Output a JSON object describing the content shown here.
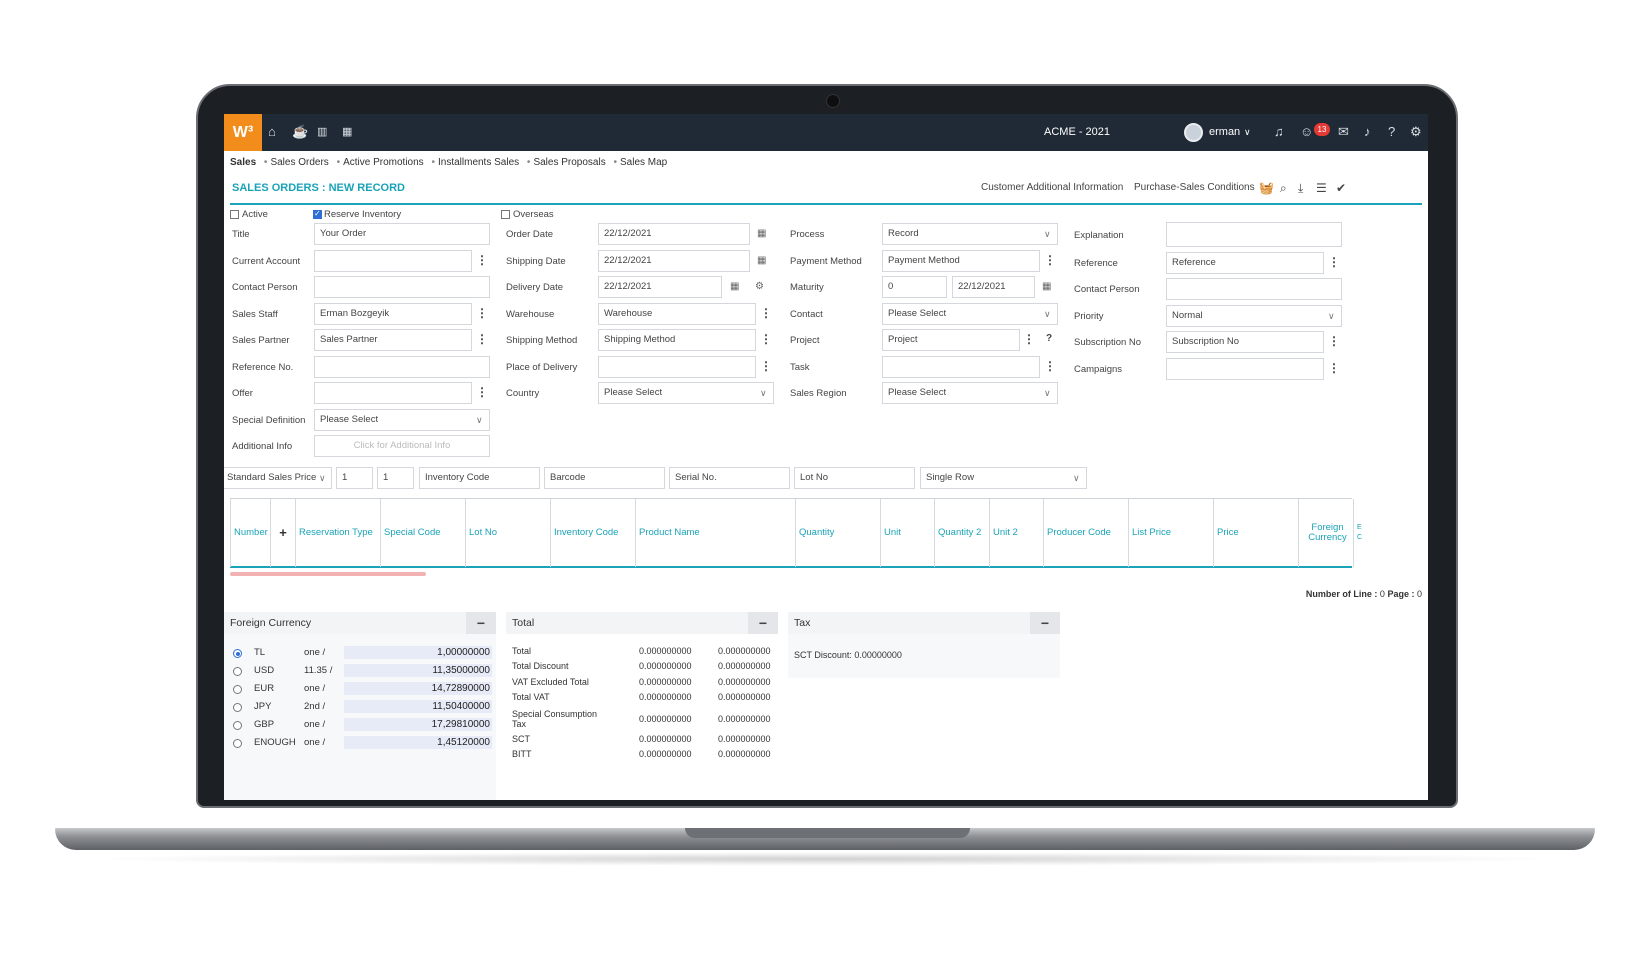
{
  "topbar": {
    "logo": "W³",
    "company": "ACME - 2021",
    "user": "erman",
    "user_chevron": "∨",
    "notif_count": "13",
    "nav_icons": [
      "home-icon",
      "coffee-icon",
      "chart-icon",
      "calendar-icon"
    ],
    "right_icons": [
      "headset-icon",
      "emoji-icon",
      "chat-icon",
      "bell-icon",
      "help-icon",
      "gear-icon"
    ]
  },
  "breadcrumbs": [
    "Sales",
    "Sales Orders",
    "Active Promotions",
    "Installments Sales",
    "Sales Proposals",
    "Sales Map"
  ],
  "page": {
    "title": "SALES ORDERS : NEW RECORD",
    "link_customer": "Customer Additional Information",
    "link_conditions": "Purchase-Sales Conditions"
  },
  "checkboxes": {
    "active": "Active",
    "reserve": "Reserve Inventory",
    "overseas": "Overseas"
  },
  "col1": {
    "title_lbl": "Title",
    "title_val": "Your Order",
    "account_lbl": "Current Account",
    "account_val": "",
    "contact_lbl": "Contact Person",
    "contact_val": "",
    "staff_lbl": "Sales Staff",
    "staff_val": "Erman Bozgeyik",
    "partner_lbl": "Sales Partner",
    "partner_val": "Sales Partner",
    "ref_lbl": "Reference No.",
    "ref_val": "",
    "offer_lbl": "Offer",
    "offer_val": "",
    "special_lbl": "Special Definition",
    "special_val": "Please Select",
    "addl_lbl": "Additional Info",
    "addl_val": "Click for Additional Info"
  },
  "col2": {
    "order_date_lbl": "Order Date",
    "order_date_val": "22/12/2021",
    "ship_date_lbl": "Shipping Date",
    "ship_date_val": "22/12/2021",
    "deliv_date_lbl": "Delivery Date",
    "deliv_date_val": "22/12/2021",
    "warehouse_lbl": "Warehouse",
    "warehouse_val": "Warehouse",
    "ship_method_lbl": "Shipping Method",
    "ship_method_val": "Shipping Method",
    "place_lbl": "Place of Delivery",
    "place_val": "",
    "country_lbl": "Country",
    "country_val": "Please Select"
  },
  "col3": {
    "process_lbl": "Process",
    "process_val": "Record",
    "payment_lbl": "Payment Method",
    "payment_val": "Payment Method",
    "maturity_lbl": "Maturity",
    "maturity_val": "0",
    "maturity_date": "22/12/2021",
    "contact_lbl": "Contact",
    "contact_val": "Please Select",
    "project_lbl": "Project",
    "project_val": "Project",
    "task_lbl": "Task",
    "task_val": "",
    "region_lbl": "Sales Region",
    "region_val": "Please Select"
  },
  "col4": {
    "expl_lbl": "Explanation",
    "expl_val": "",
    "ref_lbl": "Reference",
    "ref_val": "Reference",
    "contact_lbl": "Contact Person",
    "contact_val": "",
    "priority_lbl": "Priority",
    "priority_val": "Normal",
    "sub_lbl": "Subscription No",
    "sub_val": "Subscription No",
    "camp_lbl": "Campaigns",
    "camp_val": ""
  },
  "toolbar": {
    "price": "Standard Sales Price",
    "qty1": "1",
    "qty2": "1",
    "inv_code": "Inventory Code",
    "barcode": "Barcode",
    "serial": "Serial No.",
    "lot": "Lot No",
    "row_mode": "Single Row"
  },
  "grid": {
    "columns": [
      "Number",
      "+",
      "Reservation Type",
      "Special Code",
      "Lot No",
      "Inventory Code",
      "Product Name",
      "Quantity",
      "Unit",
      "Quantity 2",
      "Unit 2",
      "Producer Code",
      "List Price",
      "Price",
      "Foreign Currency",
      "E C"
    ],
    "line_label": "Number of Line :",
    "line_value": "0",
    "page_label": "Page :",
    "page_value": "0"
  },
  "currency_panel": {
    "title": "Foreign Currency",
    "rows": [
      {
        "code": "TL",
        "unit": "one /",
        "value": "1,00000000"
      },
      {
        "code": "USD",
        "unit": "11.35 /",
        "value": "11,35000000"
      },
      {
        "code": "EUR",
        "unit": "one /",
        "value": "14,72890000"
      },
      {
        "code": "JPY",
        "unit": "2nd /",
        "value": "11,50400000"
      },
      {
        "code": "GBP",
        "unit": "one /",
        "value": "17,29810000"
      },
      {
        "code": "ENOUGH",
        "unit": "one /",
        "value": "1,45120000"
      }
    ]
  },
  "total_panel": {
    "title": "Total",
    "rows": [
      {
        "label": "Total",
        "v1": "0.000000000",
        "v2": "0.000000000"
      },
      {
        "label": "Total Discount",
        "v1": "0.000000000",
        "v2": "0.000000000"
      },
      {
        "label": "VAT Excluded Total",
        "v1": "0.000000000",
        "v2": "0.000000000"
      },
      {
        "label": "Total VAT",
        "v1": "0.000000000",
        "v2": "0.000000000"
      },
      {
        "label": "Special Consumption Tax",
        "v1": "0.000000000",
        "v2": "0.000000000"
      },
      {
        "label": "SCT",
        "v1": "0.000000000",
        "v2": "0.000000000"
      },
      {
        "label": "BITT",
        "v1": "0.000000000",
        "v2": "0.000000000"
      }
    ]
  },
  "tax_panel": {
    "title": "Tax",
    "sct_discount": "SCT Discount: 0.00000000"
  },
  "colors": {
    "accent": "#1aa3b8",
    "topbar": "#1f2a36",
    "logo": "#f28c1a",
    "badge": "#e53935"
  }
}
